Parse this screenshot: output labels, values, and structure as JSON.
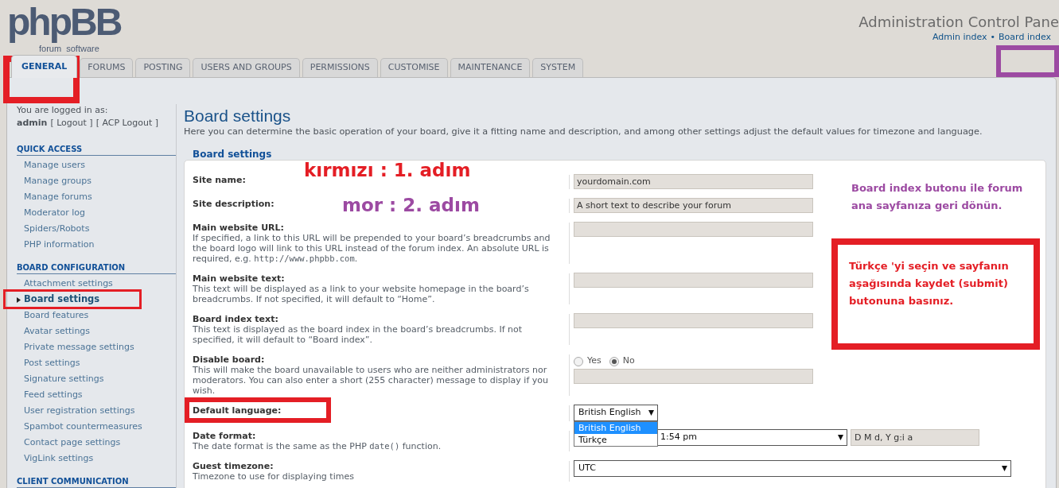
{
  "header": {
    "logo": {
      "wordmark": "phpBB",
      "tagline": "forum  software"
    },
    "title": "Administration Control Pane",
    "links": [
      "Admin index",
      "Board index"
    ],
    "separator": "•"
  },
  "tabs": [
    {
      "label": "GENERAL",
      "selected": true
    },
    {
      "label": "FORUMS",
      "selected": false
    },
    {
      "label": "POSTING",
      "selected": false
    },
    {
      "label": "USERS AND GROUPS",
      "selected": false
    },
    {
      "label": "PERMISSIONS",
      "selected": false
    },
    {
      "label": "CUSTOMISE",
      "selected": false
    },
    {
      "label": "MAINTENANCE",
      "selected": false
    },
    {
      "label": "SYSTEM",
      "selected": false
    }
  ],
  "sidebar": {
    "logged_in_text": "You are logged in as:",
    "user": "admin",
    "links": [
      "[ Logout ]",
      "[ ACP Logout ]"
    ],
    "sections": [
      {
        "title": "QUICK ACCESS",
        "items": [
          {
            "label": "Manage users",
            "selected": false
          },
          {
            "label": "Manage groups",
            "selected": false
          },
          {
            "label": "Manage forums",
            "selected": false
          },
          {
            "label": "Moderator log",
            "selected": false
          },
          {
            "label": "Spiders/Robots",
            "selected": false
          },
          {
            "label": "PHP information",
            "selected": false
          }
        ]
      },
      {
        "title": "BOARD CONFIGURATION",
        "items": [
          {
            "label": "Attachment settings",
            "selected": false
          },
          {
            "label": "Board settings",
            "selected": true
          },
          {
            "label": "Board features",
            "selected": false
          },
          {
            "label": "Avatar settings",
            "selected": false
          },
          {
            "label": "Private message settings",
            "selected": false
          },
          {
            "label": "Post settings",
            "selected": false
          },
          {
            "label": "Signature settings",
            "selected": false
          },
          {
            "label": "Feed settings",
            "selected": false
          },
          {
            "label": "User registration settings",
            "selected": false
          },
          {
            "label": "Spambot countermeasures",
            "selected": false
          },
          {
            "label": "Contact page settings",
            "selected": false
          },
          {
            "label": "VigLink settings",
            "selected": false
          }
        ]
      },
      {
        "title": "CLIENT COMMUNICATION"
      }
    ]
  },
  "content": {
    "title": "Board settings",
    "description": "Here you can determine the basic operation of your board, give it a fitting name and description, and among other settings adjust the default values for timezone and language.",
    "legend": "Board settings",
    "fields": [
      {
        "kind": "text",
        "label": "Site name:",
        "value": "yourdomain.com"
      },
      {
        "kind": "text",
        "label": "Site description:",
        "value": "A short text to describe your forum"
      },
      {
        "kind": "text",
        "label": "Main website URL:",
        "description": [
          {
            "text": "If specified, a link to this URL will be prepended to your board’s breadcrumbs and the board logo will link to this URL instead of the forum index. An absolute URL is required, e.g. ",
            "code": false
          },
          {
            "text": "http://www.phpbb.com",
            "code": true
          },
          {
            "text": ".",
            "code": false
          }
        ]
      },
      {
        "kind": "text",
        "label": "Main website text:",
        "description": [
          {
            "text": "This text will be displayed as a link to your website homepage in the board’s breadcrumbs. If not specified, it will default to “Home”.",
            "code": false
          }
        ]
      },
      {
        "kind": "text",
        "label": "Board index text:",
        "description": [
          {
            "text": "This text is displayed as the board index in the board’s breadcrumbs. If not specified, it will default to “Board index”.",
            "code": false
          }
        ]
      },
      {
        "kind": "radio",
        "label": "Disable board:",
        "description": [
          {
            "text": "This will make the board unavailable to users who are neither administrators nor moderators. You can also enter a short (255 character) message to display if you wish.",
            "code": false
          }
        ],
        "options": [
          {
            "label": "Yes",
            "selected": false
          },
          {
            "label": "No",
            "selected": true
          }
        ]
      },
      {
        "kind": "select",
        "label": "Default language:",
        "value": "British English",
        "open": true,
        "options": [
          {
            "label": "British English",
            "selected": true
          },
          {
            "label": "Türkçe",
            "selected": false
          }
        ]
      },
      {
        "kind": "date_format",
        "label": "Date format:",
        "description": [
          {
            "text": "The date format is the same as the PHP ",
            "code": false
          },
          {
            "text": "date()",
            "code": true
          },
          {
            "text": " function.",
            "code": false
          }
        ],
        "value": "1:54 pm",
        "custom_value": "D M d, Y g:i a"
      },
      {
        "kind": "select",
        "label": "Guest timezone:",
        "description": [
          {
            "text": "Timezone to use for displaying times",
            "code": false
          }
        ],
        "value": "UTC",
        "open": false
      }
    ]
  },
  "annotations": [
    {
      "kind": "frame",
      "color": "#e41e25"
    },
    {
      "kind": "frame",
      "color": "#9c4aa2"
    },
    {
      "kind": "frame",
      "color": "#e41e25"
    },
    {
      "kind": "frame",
      "color": "#e41e25"
    },
    {
      "kind": "note",
      "color": "#e41e25",
      "text": "kırmızı : 1. adım"
    },
    {
      "kind": "note",
      "color": "#9c4aa2",
      "text": "mor : 2. adım"
    },
    {
      "kind": "note",
      "color": "#9c4aa2",
      "text": "Board index butonu ile forum ana sayfanıza geri dönün."
    },
    {
      "kind": "boxed_note",
      "color": "#e41e25",
      "text": "Türkçe 'yi seçin ve sayfanın aşağısında kaydet (submit) butonuna basınız."
    }
  ]
}
